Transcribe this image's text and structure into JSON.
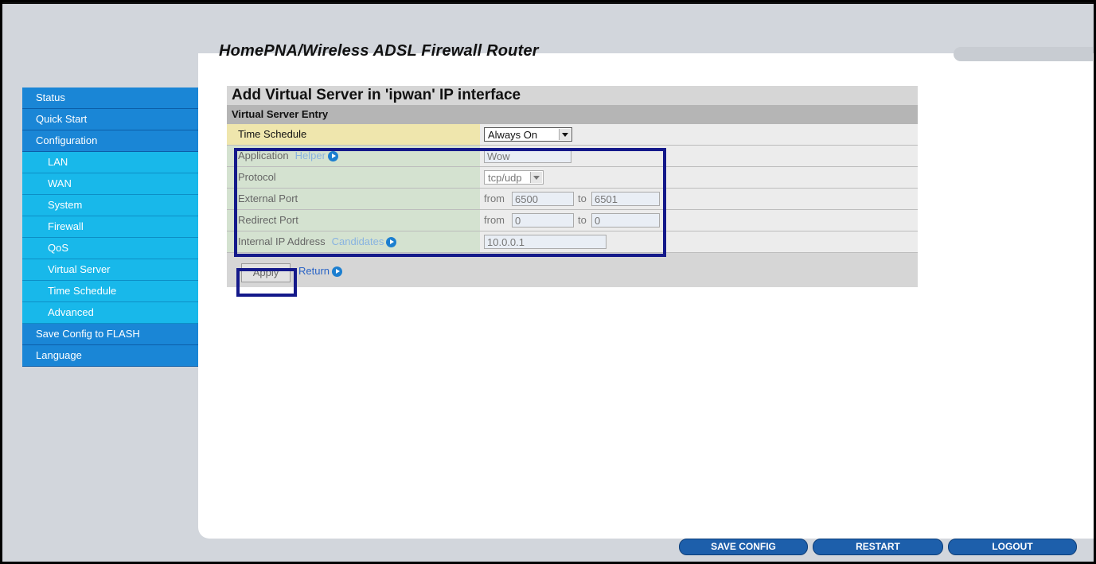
{
  "header": {
    "title": "HomePNA/Wireless ADSL Firewall Router"
  },
  "sidebar": {
    "items": [
      {
        "label": "Status"
      },
      {
        "label": "Quick Start"
      },
      {
        "label": "Configuration"
      },
      {
        "label": "LAN"
      },
      {
        "label": "WAN"
      },
      {
        "label": "System"
      },
      {
        "label": "Firewall"
      },
      {
        "label": "QoS"
      },
      {
        "label": "Virtual Server"
      },
      {
        "label": "Time Schedule"
      },
      {
        "label": "Advanced"
      },
      {
        "label": "Save Config to FLASH"
      },
      {
        "label": "Language"
      }
    ]
  },
  "main": {
    "title": "Add Virtual Server in 'ipwan' IP interface",
    "section": "Virtual Server Entry",
    "time_schedule": {
      "label": "Time Schedule",
      "value": "Always On"
    },
    "application": {
      "label": "Application",
      "helper": "Helper",
      "value": "Wow"
    },
    "protocol": {
      "label": "Protocol",
      "value": "tcp/udp"
    },
    "external_port": {
      "label": "External Port",
      "from_label": "from",
      "from": "6500",
      "to_label": "to",
      "to": "6501"
    },
    "redirect_port": {
      "label": "Redirect Port",
      "from_label": "from",
      "from": "0",
      "to_label": "to",
      "to": "0"
    },
    "internal_ip": {
      "label": "Internal IP Address",
      "candidates": "Candidates",
      "value": "10.0.0.1"
    },
    "apply_label": "Apply",
    "return_label": "Return"
  },
  "footer": {
    "save_config": "SAVE CONFIG",
    "restart": "RESTART",
    "logout": "LOGOUT"
  },
  "colors": {
    "nav": "#1a86d6",
    "subnav": "#18b8ea",
    "highlight": "#14198a"
  }
}
